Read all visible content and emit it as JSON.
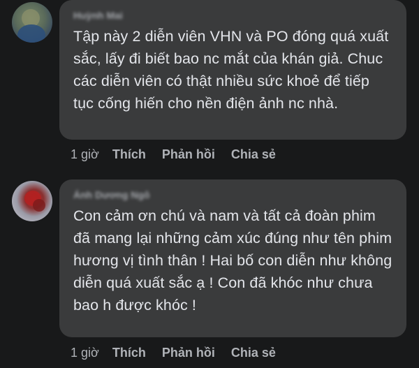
{
  "comments": [
    {
      "author": "Huỳnh Mai",
      "text": "Tập này 2 diễn viên VHN và PO đóng quá xuất sắc, lấy đi biết bao nc mắt của khán giả. Chuc các diễn viên có thật nhiều sức khoẻ để tiếp tục cống hiến cho nền điện ảnh nc nhà.",
      "time": "1 giờ",
      "like": "Thích",
      "reply": "Phản hồi",
      "share": "Chia sẻ"
    },
    {
      "author": "Ánh Dương Ngô",
      "text": "Con cảm ơn chú và nam và tất cả đoàn phim đã mang lại những cảm xúc đúng như tên phim hương vị tình thân ! Hai bố con diễn như không diễn quá xuất sắc ạ ! Con đã khóc như chưa bao h được khóc !",
      "time": "1 giờ",
      "like": "Thích",
      "reply": "Phản hồi",
      "share": "Chia sẻ"
    }
  ]
}
